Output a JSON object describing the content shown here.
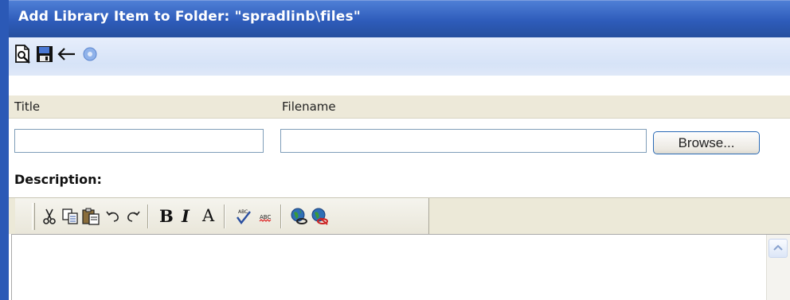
{
  "window": {
    "title": "Add Library Item to Folder: \"spradlinb\\files\""
  },
  "toolbar": {
    "icons": [
      "preview-icon",
      "save-icon",
      "back-arrow-icon",
      "help-icon"
    ]
  },
  "form": {
    "title_label": "Title",
    "filename_label": "Filename",
    "title_value": "",
    "filename_value": "",
    "browse_label": "Browse...",
    "description_label": "Description:"
  },
  "editor_toolbar": {
    "bold_label": "B",
    "italic_label": "I",
    "font_label": "A",
    "icons": [
      "cut-icon",
      "copy-icon",
      "paste-icon",
      "undo-icon",
      "redo-icon",
      "bold-icon",
      "italic-icon",
      "font-color-icon",
      "spellcheck-icon",
      "spellcheck-as-you-type-icon",
      "hyperlink-icon",
      "remove-hyperlink-icon"
    ]
  },
  "colors": {
    "title_bar": "#2e5cba",
    "toolbar": "#d6e3f7",
    "header_row": "#ede9d9",
    "editor_toolbar": "#ece9d8"
  }
}
